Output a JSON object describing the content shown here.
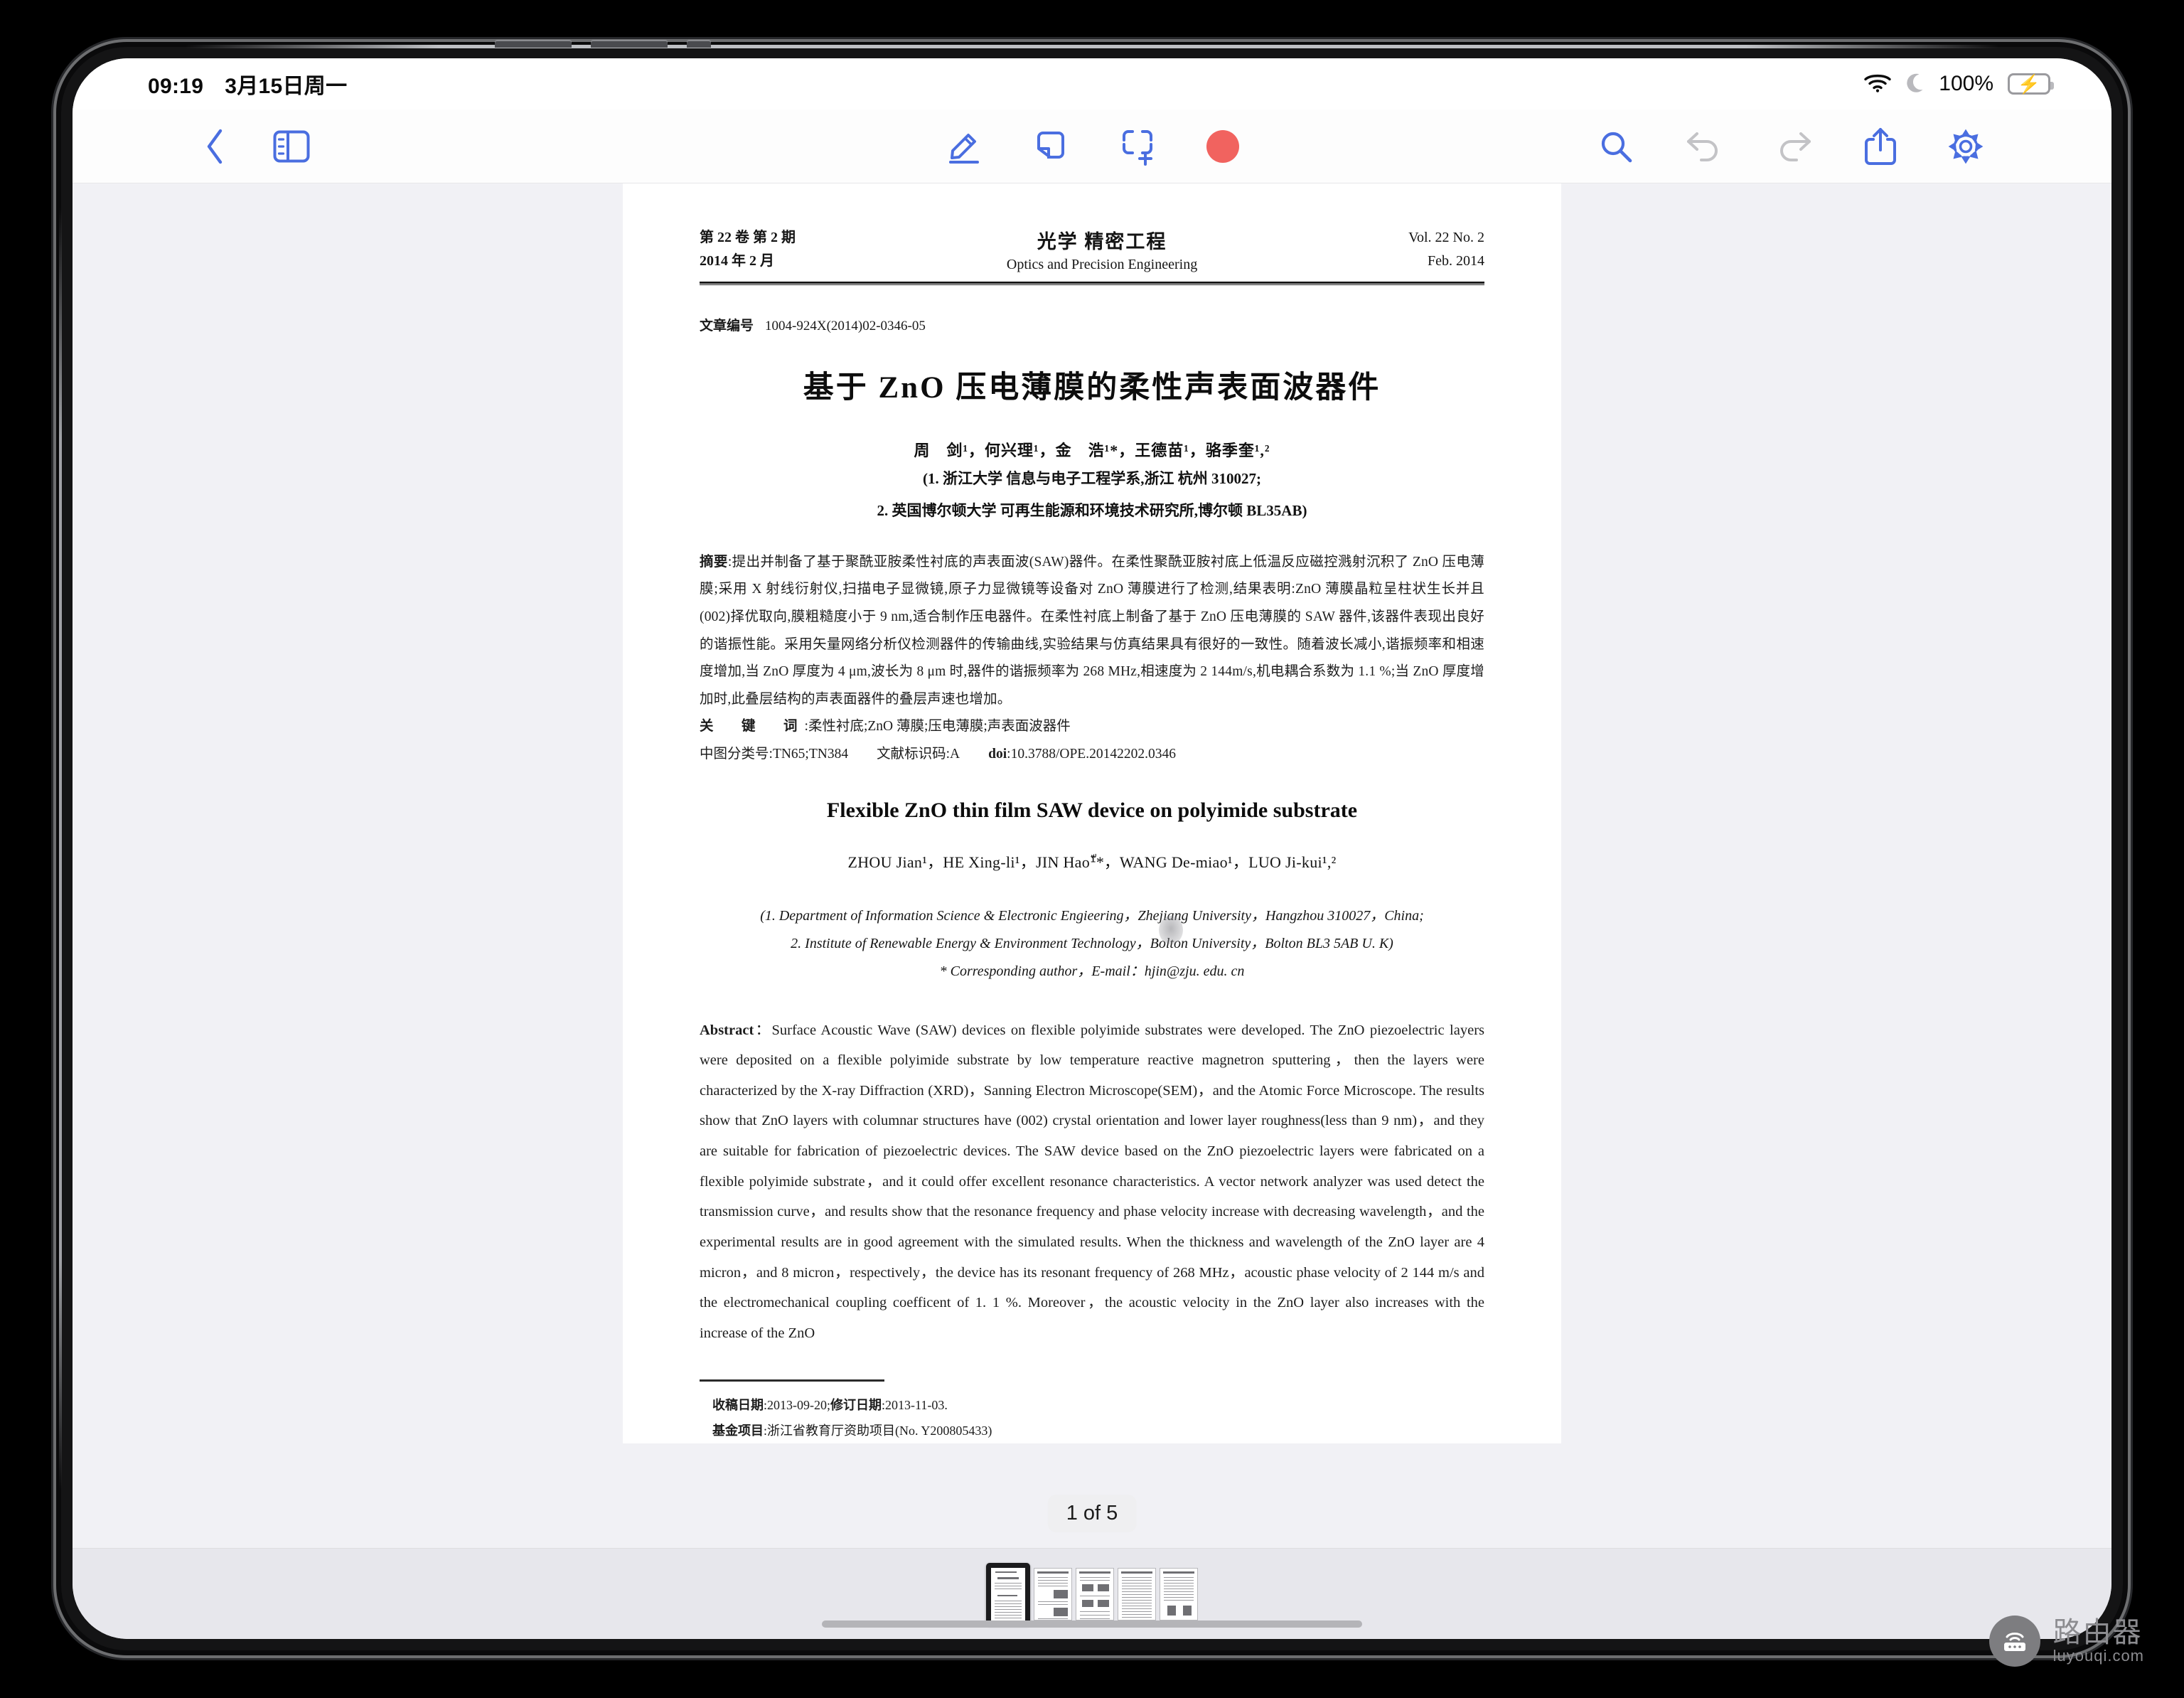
{
  "status_bar": {
    "time": "09:19",
    "date": "3月15日周一",
    "battery_percent": "100%",
    "icons": [
      "wifi-icon",
      "moon-icon",
      "battery-charging-icon"
    ]
  },
  "toolbar": {
    "left": [
      {
        "name": "back-button",
        "icon": "chevron-left-icon"
      },
      {
        "name": "sidebar-toggle-button",
        "icon": "sidebar-icon"
      }
    ],
    "center": [
      {
        "name": "markup-pen-button",
        "icon": "pencil-underline-icon"
      },
      {
        "name": "sticky-note-button",
        "icon": "note-corner-icon"
      },
      {
        "name": "add-selection-button",
        "icon": "square-plus-icon"
      },
      {
        "name": "record-button",
        "icon": "record-dot-icon",
        "color": "#f1635f"
      }
    ],
    "right": [
      {
        "name": "search-button",
        "icon": "search-icon"
      },
      {
        "name": "undo-button",
        "icon": "undo-arrow-icon",
        "disabled": true
      },
      {
        "name": "redo-button",
        "icon": "redo-arrow-icon",
        "disabled": true
      },
      {
        "name": "share-button",
        "icon": "share-up-icon"
      },
      {
        "name": "settings-button",
        "icon": "gear-icon"
      }
    ],
    "accent_color": "#4a6ee0",
    "disabled_color": "#c3c3c6"
  },
  "document": {
    "masthead": {
      "volume_cn": "第 22 卷   第 2 期",
      "date_cn": "2014 年 2 月",
      "journal_cn": "光学 精密工程",
      "journal_en": "Optics and Precision Engineering",
      "volume_en": "Vol. 22    No. 2",
      "date_en": "Feb. 2014"
    },
    "article_number_label": "文章编号",
    "article_number": "1004-924X(2014)02-0346-05",
    "title_cn": "基于 ZnO 压电薄膜的柔性声表面波器件",
    "authors_cn": "周　剑¹，何兴理¹，金　浩¹*，王德苗¹，骆季奎¹,²",
    "affiliations_cn": [
      "(1. 浙江大学 信息与电子工程学系,浙江 杭州 310027;",
      "2. 英国博尔顿大学 可再生能源和环境技术研究所,博尔顿 BL35AB)"
    ],
    "abstract_cn_label": "摘要",
    "abstract_cn": "提出并制备了基于聚酰亚胺柔性衬底的声表面波(SAW)器件。在柔性聚酰亚胺衬底上低温反应磁控溅射沉积了 ZnO 压电薄膜;采用 X 射线衍射仪,扫描电子显微镜,原子力显微镜等设备对 ZnO 薄膜进行了检测,结果表明:ZnO 薄膜晶粒呈柱状生长并且(002)择优取向,膜粗糙度小于 9 nm,适合制作压电器件。在柔性衬底上制备了基于 ZnO 压电薄膜的 SAW 器件,该器件表现出良好的谐振性能。采用矢量网络分析仪检测器件的传输曲线,实验结果与仿真结果具有很好的一致性。随着波长减小,谐振频率和相速度增加,当 ZnO 厚度为 4 μm,波长为 8 μm 时,器件的谐振频率为 268 MHz,相速度为 2 144m/s,机电耦合系数为 1.1 %;当 ZnO 厚度增加时,此叠层结构的声表面器件的叠层声速也增加。",
    "keywords_label": "关　键　词",
    "keywords_cn": "柔性衬底;ZnO 薄膜;压电薄膜;声表面波器件",
    "clc_label": "中图分类号",
    "clc_value": "TN65;TN384",
    "doc_code_label": "文献标识码",
    "doc_code_value": "A",
    "doi_label": "doi",
    "doi_value": "10.3788/OPE.20142202.0346",
    "title_en": "Flexible ZnO thin film SAW device on polyimide substrate",
    "authors_en": "ZHOU Jian¹，HE Xing-li¹，JIN Hao¹ّ*，WANG De-miao¹，LUO Ji-kui¹,²",
    "affiliations_en": [
      "(1. Department of Information Science & Electronic Engieering，Zhejiang University，Hangzhou 310027，China;",
      "2.  Institute of Renewable Energy & Environment Technology，Bolton University，Bolton BL3 5AB U. K)",
      "* Corresponding author，E-mail：hjin@zju. edu. cn"
    ],
    "abstract_en_label": "Abstract",
    "abstract_en": "Surface Acoustic Wave (SAW) devices on flexible polyimide substrates were developed. The ZnO piezoelectric layers were deposited on a flexible polyimide substrate by low temperature reactive magnetron sputtering，then the layers were characterized by the X-ray Diffraction (XRD)，Sanning Electron Microscope(SEM)，and the Atomic Force Microscope. The results show that ZnO layers with columnar structures have (002) crystal orientation and lower layer roughness(less than 9 nm)，and they are suitable for fabrication of piezoelectric devices. The SAW device based on the ZnO piezoelectric layers were fabricated on a flexible polyimide substrate，and it could offer excellent resonance characteristics. A vector network analyzer was used detect the transmission curve，and results show that the resonance frequency and phase velocity increase with decreasing wavelength，and the experimental results are in good agreement with the simulated results. When the thickness and wavelength of the ZnO layer are 4 micron，and 8 micron，respectively，the device has its resonant frequency of 268 MHz，acoustic phase velocity of 2 144 m/s and the electromechanical coupling coefficent of 1. 1 %. Moreover，the acoustic velocity in the ZnO layer also increases with the increase of the ZnO",
    "footnote_received_label": "收稿日期",
    "footnote_received": "2013-09-20;",
    "footnote_revised_label": "修订日期",
    "footnote_revised": "2013-11-03.",
    "footnote_fund_label": "基金项目",
    "footnote_fund": "浙江省教育厅资助项目(No. Y200805433)"
  },
  "page_indicator": "1 of 5",
  "thumbnails": {
    "count": 5,
    "current_index": 1
  },
  "watermark": {
    "cn": "路由器",
    "en": "luyouqi.com",
    "icon": "router-icon"
  }
}
